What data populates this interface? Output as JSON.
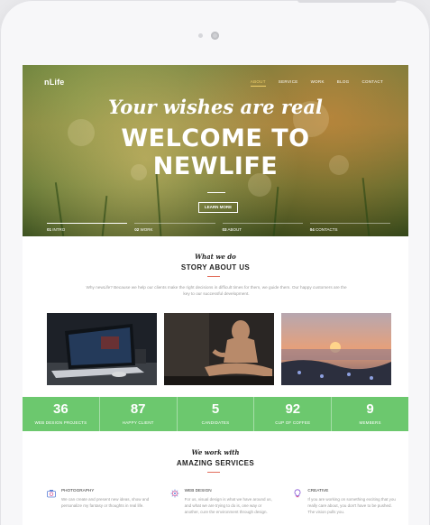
{
  "hero": {
    "logo": "nLife",
    "nav": [
      "ABOUT",
      "SERVICE",
      "WORK",
      "BLOG",
      "CONTACT"
    ],
    "script_title": "Your wishes are real",
    "title_line1": "WELCOME TO",
    "title_line2": "NEWLIFE",
    "button": "LEARN MORE",
    "steps": [
      {
        "num": "01",
        "label": "INTRO"
      },
      {
        "num": "02",
        "label": "WORK"
      },
      {
        "num": "03",
        "label": "ABOUT"
      },
      {
        "num": "04",
        "label": "CONTACTS"
      }
    ]
  },
  "about": {
    "script": "What we do",
    "title": "STORY ABOUT US",
    "text": "Why newLife? Because we help our clients make the right decisions in difficult times for them, we guide them. Our happy customers are the key to our successful development."
  },
  "stats": [
    {
      "value": "36",
      "label": "WEB DESIGN PROJECTS"
    },
    {
      "value": "87",
      "label": "HAPPY CLIENT"
    },
    {
      "value": "5",
      "label": "CANDIDATES"
    },
    {
      "value": "92",
      "label": "CUP OF COFFEE"
    },
    {
      "value": "9",
      "label": "MEMBERS"
    }
  ],
  "services": {
    "script": "We work with",
    "title": "AMAZING SERVICES",
    "items": [
      {
        "title": "PHOTOGRAPHY",
        "text": "We can create and present new ideas, show and personalize my fantasy or thoughts in real life."
      },
      {
        "title": "WEB DESIGN",
        "text": "For us, visual design is what we have around us, and what we are trying to do is, one way or another, cure the environment through design."
      },
      {
        "title": "CREATIVE",
        "text": "If you are working on something exciting that you really care about, you don't have to be pushed. The vision pulls you."
      }
    ]
  },
  "colors": {
    "accent_green": "#6cc86e",
    "nav_active": "#f3d26b",
    "accent_line": "#e26e5c"
  }
}
